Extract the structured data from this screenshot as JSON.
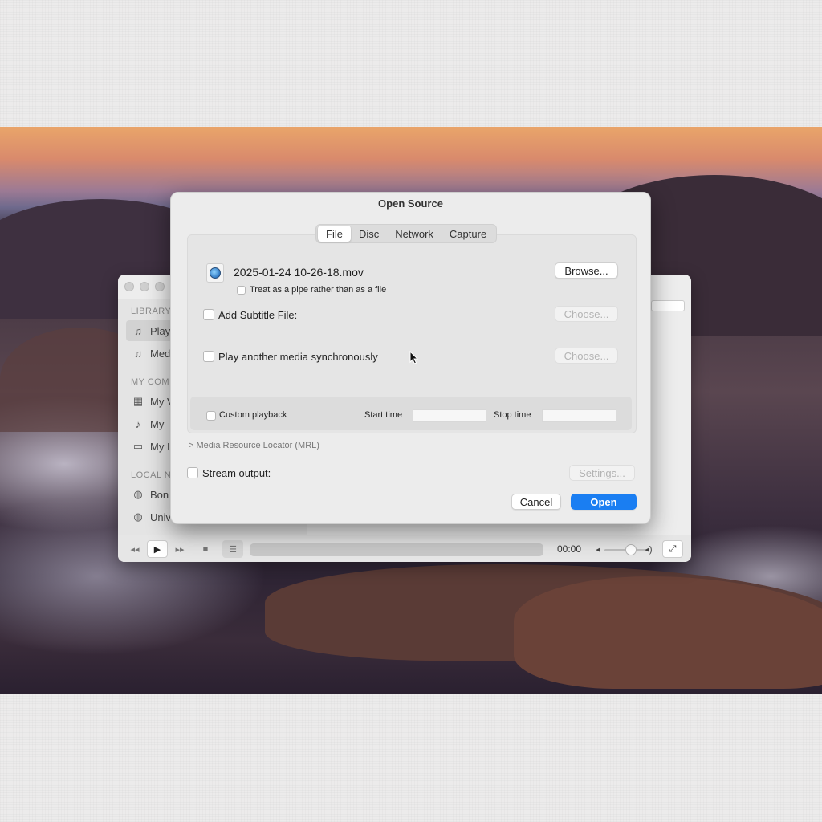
{
  "dialog": {
    "title": "Open Source",
    "tabs": [
      "File",
      "Disc",
      "Network",
      "Capture"
    ],
    "active_tab": "File",
    "file_name": "2025-01-24 10-26-18.mov",
    "browse_label": "Browse...",
    "pipe_label": "Treat as a pipe rather than as a file",
    "subtitle_label": "Add Subtitle File:",
    "choose_label": "Choose...",
    "sync_label": "Play another media synchronously",
    "custom_playback_label": "Custom playback",
    "start_time_label": "Start time",
    "stop_time_label": "Stop time",
    "mrl_label": "Media Resource Locator (MRL)",
    "mrl_chevron": ">",
    "stream_output_label": "Stream output:",
    "settings_label": "Settings...",
    "cancel_label": "Cancel",
    "open_label": "Open"
  },
  "vlc_window": {
    "sidebar": {
      "library_header": "LIBRARY",
      "library_items": [
        "Play",
        "Med"
      ],
      "computer_header": "MY COMI",
      "computer_items": [
        "My V",
        "My",
        "My I"
      ],
      "network_header": "LOCAL N",
      "network_items": [
        "Bon",
        "Univ"
      ]
    },
    "controls": {
      "time": "00:00"
    }
  },
  "colors": {
    "accent": "#1a7ef2"
  }
}
